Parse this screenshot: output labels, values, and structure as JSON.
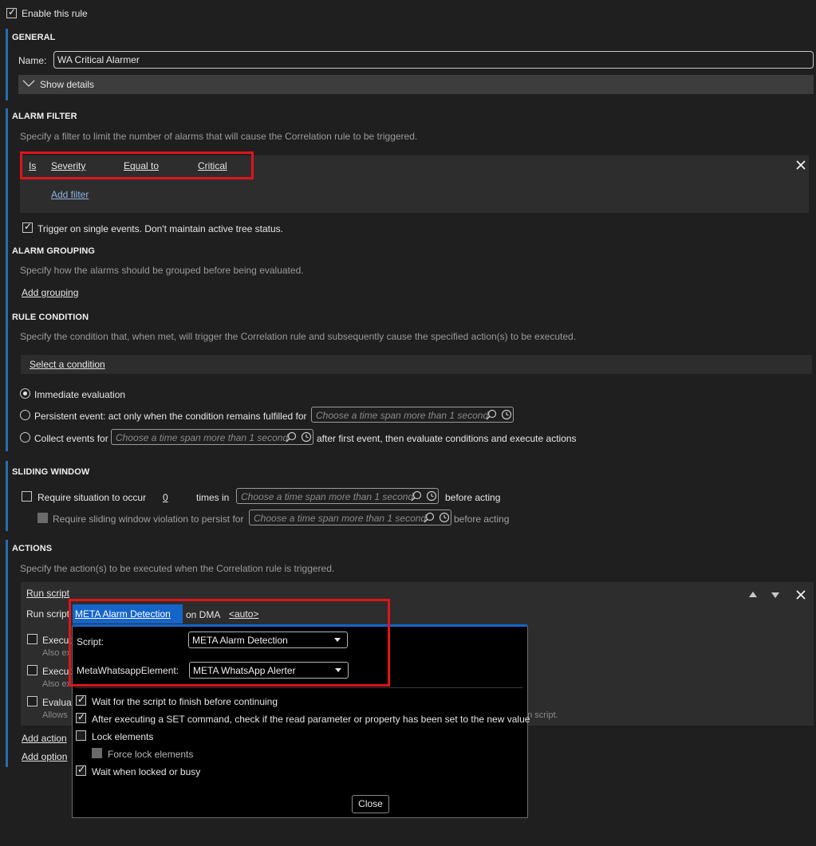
{
  "enable_rule": {
    "label": "Enable this rule",
    "checked": true
  },
  "general": {
    "title": "GENERAL",
    "name_label": "Name:",
    "name_value": "WA Critical Alarmer",
    "show_details": "Show details"
  },
  "alarm_filter": {
    "title": "ALARM FILTER",
    "description": "Specify a filter to limit the number of alarms that will cause the Correlation rule to be triggered.",
    "filter": {
      "op1": "Is",
      "field": "Severity",
      "comparator": "Equal to",
      "value": "Critical"
    },
    "add_filter": "Add filter",
    "trigger_single": {
      "label": "Trigger on single events. Don't maintain active tree status.",
      "checked": true
    }
  },
  "alarm_grouping": {
    "title": "ALARM GROUPING",
    "description": "Specify how the alarms should be grouped before being evaluated.",
    "add_grouping": "Add grouping"
  },
  "rule_condition": {
    "title": "RULE CONDITION",
    "description": "Specify the condition that, when met, will trigger the Correlation rule and subsequently cause the specified action(s) to be executed.",
    "select_condition": "Select a condition",
    "immediate": "Immediate evaluation",
    "persistent": "Persistent event: act only when the condition remains fulfilled for",
    "collect": "Collect events for",
    "collect_suffix": "after first event, then evaluate conditions and execute actions",
    "timespan_placeholder": "Choose a time span more than 1 second"
  },
  "sliding_window": {
    "title": "SLIDING WINDOW",
    "require_occur": "Require situation to occur",
    "count": "0",
    "times_in": "times in",
    "before_acting": "before acting",
    "require_violation": "Require sliding window violation to persist for",
    "timespan_placeholder": "Choose a time span more than 1 second"
  },
  "actions": {
    "title": "ACTIONS",
    "description": "Specify the action(s) to be executed when the Correlation rule is triggered.",
    "run_script_header": "Run script",
    "run_script_label": "Run script",
    "script_link": "META Alarm Detection",
    "on_dma": "on DMA",
    "auto": "<auto>",
    "hidden_rows": [
      {
        "label": "Execut",
        "sub": "Also ex"
      },
      {
        "label": "Execut",
        "sub": "Also ex"
      },
      {
        "label": "Evaluat",
        "sub": "Allows"
      }
    ],
    "trailing_text": "on script.",
    "add_action": "Add action",
    "add_option": "Add option"
  },
  "popup": {
    "script_label": "Script:",
    "script_value": "META Alarm Detection",
    "element_label": "MetaWhatsappElement:",
    "element_value": "META WhatsApp Alerter",
    "options": [
      {
        "label": "Wait for the script to finish before continuing",
        "checked": true
      },
      {
        "label": "After executing a SET command, check if the read parameter or property has been set to the new value",
        "checked": true
      },
      {
        "label": "Lock elements",
        "checked": false
      },
      {
        "label": "Force lock elements",
        "checked": false
      },
      {
        "label": "Wait when locked or busy",
        "checked": true
      }
    ],
    "close": "Close"
  },
  "colors": {
    "accent": "#2a6bb5",
    "highlight": "#e0141a",
    "background": "#1f1f1f",
    "panel": "#2d2d2d"
  },
  "icons": [
    "check-icon",
    "chevron-down-icon",
    "close-icon",
    "search-icon",
    "clock-icon",
    "arrow-up-icon",
    "arrow-down-icon",
    "dropdown-arrow-icon"
  ]
}
